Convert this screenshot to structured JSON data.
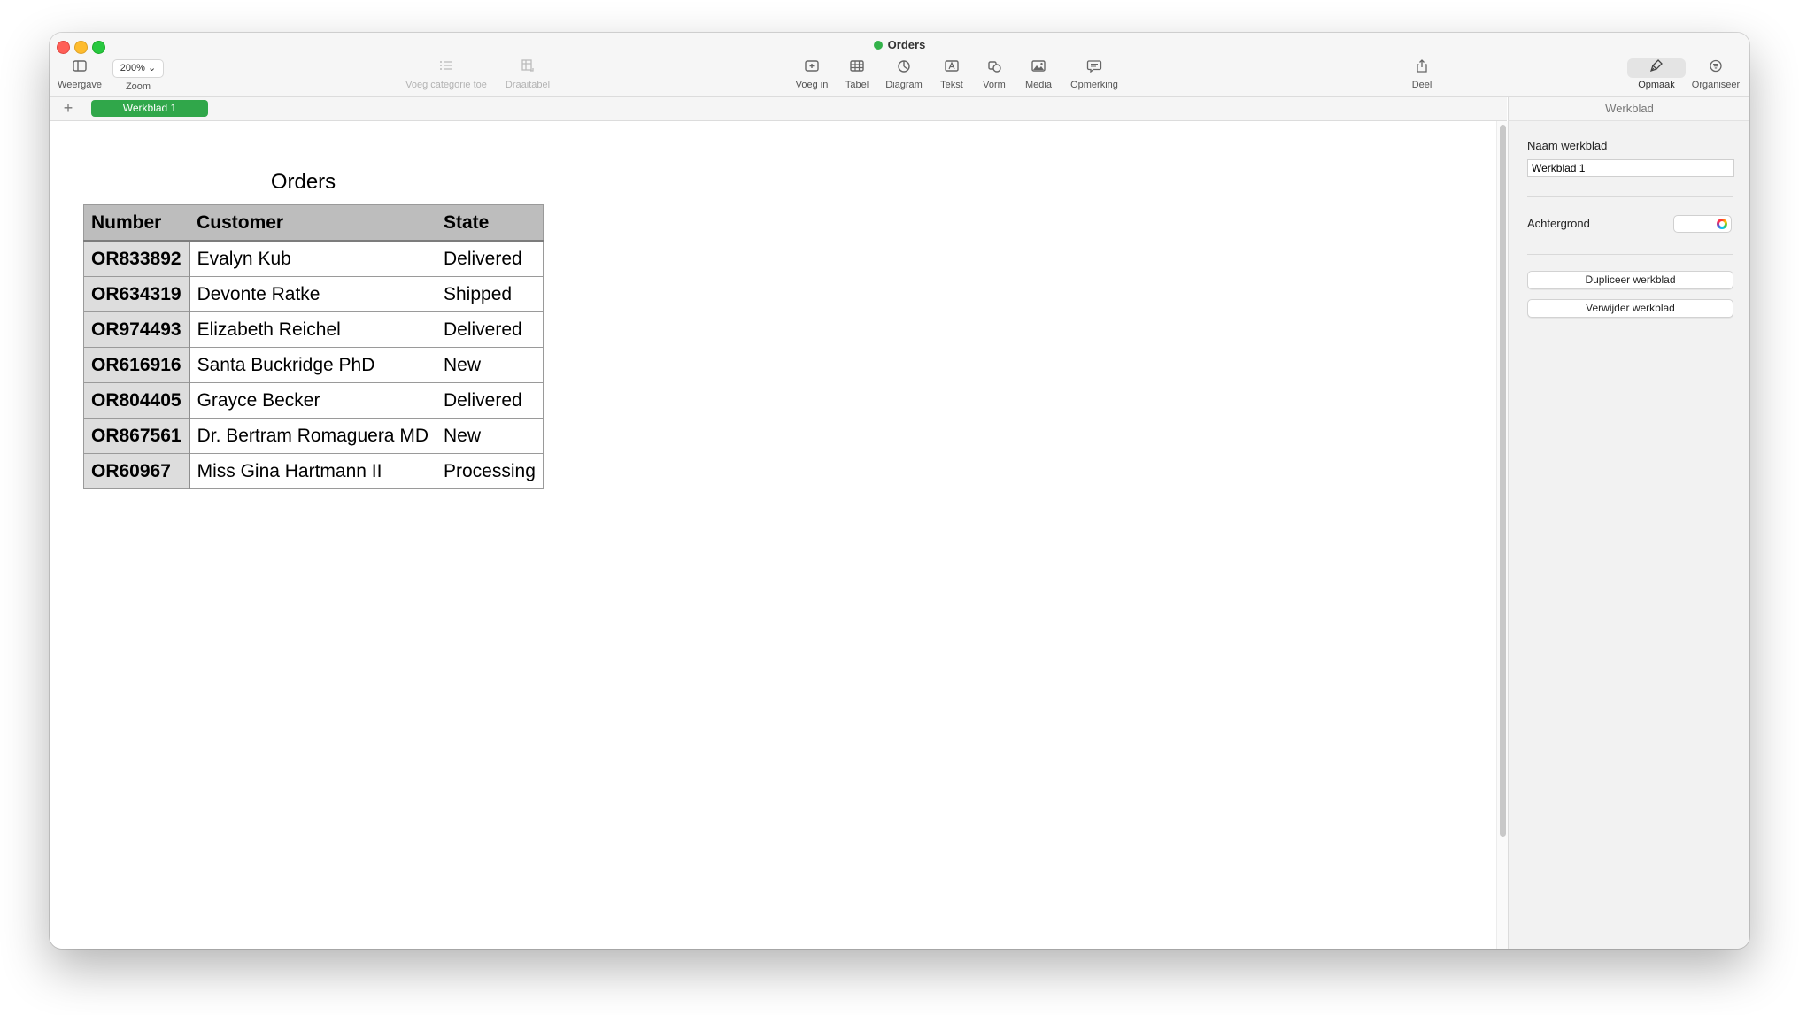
{
  "window": {
    "title": "Orders"
  },
  "toolbar": {
    "view_label": "Weergave",
    "zoom_value": "200%",
    "zoom_label": "Zoom",
    "add_category_label": "Voeg categorie toe",
    "pivot_label": "Draaitabel",
    "insert_label": "Voeg in",
    "table_label": "Tabel",
    "chart_label": "Diagram",
    "text_label": "Tekst",
    "shape_label": "Vorm",
    "media_label": "Media",
    "comment_label": "Opmerking",
    "share_label": "Deel",
    "format_label": "Opmaak",
    "organize_label": "Organiseer"
  },
  "sheets": {
    "add_symbol": "+",
    "active_tab": "Werkblad 1"
  },
  "table": {
    "title": "Orders",
    "headers": [
      "Number",
      "Customer",
      "State"
    ],
    "rows": [
      [
        "OR833892",
        "Evalyn Kub",
        "Delivered"
      ],
      [
        "OR634319",
        "Devonte Ratke",
        "Shipped"
      ],
      [
        "OR974493",
        "Elizabeth Reichel",
        "Delivered"
      ],
      [
        "OR616916",
        "Santa Buckridge PhD",
        "New"
      ],
      [
        "OR804405",
        "Grayce Becker",
        "Delivered"
      ],
      [
        "OR867561",
        "Dr. Bertram Romaguera MD",
        "New"
      ],
      [
        "OR60967",
        "Miss Gina Hartmann II",
        "Processing"
      ]
    ]
  },
  "sidebar": {
    "header": "Werkblad",
    "sheet_name_label": "Naam werkblad",
    "sheet_name_value": "Werkblad 1",
    "background_label": "Achtergrond",
    "duplicate_button": "Dupliceer werkblad",
    "delete_button": "Verwijder werkblad"
  },
  "colors": {
    "accent": "#30a74a",
    "header_fill": "#bdbdbd",
    "number_fill": "#dddddd"
  }
}
